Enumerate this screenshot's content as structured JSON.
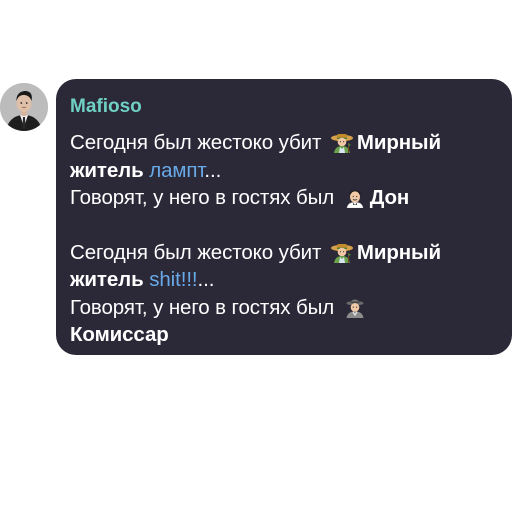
{
  "chat": {
    "sender_name": "Mafioso",
    "avatar_icon": "mafioso-avatar",
    "colors": {
      "bubble_bg": "#2b2838",
      "sender_name": "#6fd0c3",
      "mention": "#68a9e8",
      "text": "#ffffff"
    },
    "message": {
      "para1": {
        "line1_prefix": "Сегодня был жестоко убит ",
        "role1": "Мирный житель",
        "victim1": "лампт",
        "victim1_suffix": "...",
        "line3_prefix": "Говорят, у него в гостях был ",
        "role2": "Дон"
      },
      "para2": {
        "line1_prefix": "Сегодня был жестоко убит ",
        "role1": "Мирный житель",
        "victim1": "shit!!!",
        "victim1_suffix": "...",
        "line3_prefix": "Говорят, у него в гостях был ",
        "role2": "Комиссар"
      }
    }
  }
}
